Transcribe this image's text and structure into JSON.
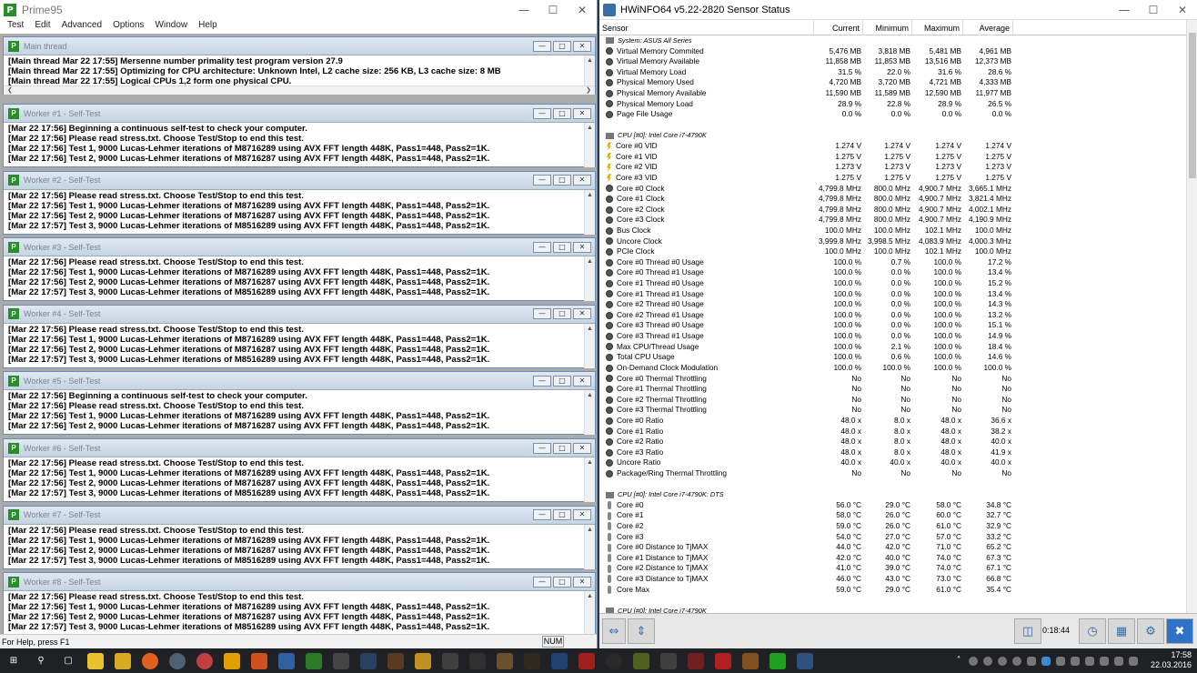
{
  "prime": {
    "title": "Prime95",
    "menus": [
      "Test",
      "Edit",
      "Advanced",
      "Options",
      "Window",
      "Help"
    ],
    "main_title": "Main thread",
    "main_lines": [
      "[Main thread Mar 22 17:55] Mersenne number primality test program version 27.9",
      "[Main thread Mar 22 17:55] Optimizing for CPU architecture: Unknown Intel, L2 cache size: 256 KB, L3 cache size: 8 MB",
      "[Main thread Mar 22 17:55] Logical CPUs 1,2 form one physical CPU."
    ],
    "workers": [
      {
        "title": "Worker #1 - Self-Test",
        "lines": [
          "[Mar 22 17:56] Beginning a continuous self-test to check your computer.",
          "[Mar 22 17:56] Please read stress.txt.  Choose Test/Stop to end this test.",
          "[Mar 22 17:56] Test 1, 9000 Lucas-Lehmer iterations of M8716289 using AVX FFT length 448K, Pass1=448, Pass2=1K.",
          "[Mar 22 17:56] Test 2, 9000 Lucas-Lehmer iterations of M8716287 using AVX FFT length 448K, Pass1=448, Pass2=1K."
        ]
      },
      {
        "title": "Worker #2 - Self-Test",
        "lines": [
          "[Mar 22 17:56] Please read stress.txt.  Choose Test/Stop to end this test.",
          "[Mar 22 17:56] Test 1, 9000 Lucas-Lehmer iterations of M8716289 using AVX FFT length 448K, Pass1=448, Pass2=1K.",
          "[Mar 22 17:56] Test 2, 9000 Lucas-Lehmer iterations of M8716287 using AVX FFT length 448K, Pass1=448, Pass2=1K.",
          "[Mar 22 17:57] Test 3, 9000 Lucas-Lehmer iterations of M8516289 using AVX FFT length 448K, Pass1=448, Pass2=1K."
        ]
      },
      {
        "title": "Worker #3 - Self-Test",
        "lines": [
          "[Mar 22 17:56] Please read stress.txt.  Choose Test/Stop to end this test.",
          "[Mar 22 17:56] Test 1, 9000 Lucas-Lehmer iterations of M8716289 using AVX FFT length 448K, Pass1=448, Pass2=1K.",
          "[Mar 22 17:56] Test 2, 9000 Lucas-Lehmer iterations of M8716287 using AVX FFT length 448K, Pass1=448, Pass2=1K.",
          "[Mar 22 17:57] Test 3, 9000 Lucas-Lehmer iterations of M8516289 using AVX FFT length 448K, Pass1=448, Pass2=1K."
        ]
      },
      {
        "title": "Worker #4 - Self-Test",
        "lines": [
          "[Mar 22 17:56] Please read stress.txt.  Choose Test/Stop to end this test.",
          "[Mar 22 17:56] Test 1, 9000 Lucas-Lehmer iterations of M8716289 using AVX FFT length 448K, Pass1=448, Pass2=1K.",
          "[Mar 22 17:56] Test 2, 9000 Lucas-Lehmer iterations of M8716287 using AVX FFT length 448K, Pass1=448, Pass2=1K.",
          "[Mar 22 17:57] Test 3, 9000 Lucas-Lehmer iterations of M8516289 using AVX FFT length 448K, Pass1=448, Pass2=1K."
        ]
      },
      {
        "title": "Worker #5 - Self-Test",
        "lines": [
          "[Mar 22 17:56] Beginning a continuous self-test to check your computer.",
          "[Mar 22 17:56] Please read stress.txt.  Choose Test/Stop to end this test.",
          "[Mar 22 17:56] Test 1, 9000 Lucas-Lehmer iterations of M8716289 using AVX FFT length 448K, Pass1=448, Pass2=1K.",
          "[Mar 22 17:56] Test 2, 9000 Lucas-Lehmer iterations of M8716287 using AVX FFT length 448K, Pass1=448, Pass2=1K."
        ]
      },
      {
        "title": "Worker #6 - Self-Test",
        "lines": [
          "[Mar 22 17:56] Please read stress.txt.  Choose Test/Stop to end this test.",
          "[Mar 22 17:56] Test 1, 9000 Lucas-Lehmer iterations of M8716289 using AVX FFT length 448K, Pass1=448, Pass2=1K.",
          "[Mar 22 17:56] Test 2, 9000 Lucas-Lehmer iterations of M8716287 using AVX FFT length 448K, Pass1=448, Pass2=1K.",
          "[Mar 22 17:57] Test 3, 9000 Lucas-Lehmer iterations of M8516289 using AVX FFT length 448K, Pass1=448, Pass2=1K."
        ]
      },
      {
        "title": "Worker #7 - Self-Test",
        "lines": [
          "[Mar 22 17:56] Please read stress.txt.  Choose Test/Stop to end this test.",
          "[Mar 22 17:56] Test 1, 9000 Lucas-Lehmer iterations of M8716289 using AVX FFT length 448K, Pass1=448, Pass2=1K.",
          "[Mar 22 17:56] Test 2, 9000 Lucas-Lehmer iterations of M8716287 using AVX FFT length 448K, Pass1=448, Pass2=1K.",
          "[Mar 22 17:57] Test 3, 9000 Lucas-Lehmer iterations of M8516289 using AVX FFT length 448K, Pass1=448, Pass2=1K."
        ]
      },
      {
        "title": "Worker #8 - Self-Test",
        "lines": [
          "[Mar 22 17:56] Please read stress.txt.  Choose Test/Stop to end this test.",
          "[Mar 22 17:56] Test 1, 9000 Lucas-Lehmer iterations of M8716289 using AVX FFT length 448K, Pass1=448, Pass2=1K.",
          "[Mar 22 17:56] Test 2, 9000 Lucas-Lehmer iterations of M8716287 using AVX FFT length 448K, Pass1=448, Pass2=1K.",
          "[Mar 22 17:57] Test 3, 9000 Lucas-Lehmer iterations of M8516289 using AVX FFT length 448K, Pass1=448, Pass2=1K."
        ]
      }
    ],
    "status_text": "For Help, press F1",
    "status_num": "NUM"
  },
  "hwinfo": {
    "title": "HWiNFO64 v5.22-2820 Sensor Status",
    "columns": {
      "sensor": "Sensor",
      "current": "Current",
      "minimum": "Minimum",
      "maximum": "Maximum",
      "average": "Average"
    },
    "rows": [
      {
        "kind": "group",
        "name": "System: ASUS All Series"
      },
      {
        "kind": "dot",
        "name": "Virtual Memory Commited",
        "cur": "5,476 MB",
        "min": "3,818 MB",
        "max": "5,481 MB",
        "avg": "4,961 MB"
      },
      {
        "kind": "dot",
        "name": "Virtual Memory Available",
        "cur": "11,858 MB",
        "min": "11,853 MB",
        "max": "13,516 MB",
        "avg": "12,373 MB"
      },
      {
        "kind": "dot",
        "name": "Virtual Memory Load",
        "cur": "31.5 %",
        "min": "22.0 %",
        "max": "31.6 %",
        "avg": "28.6 %"
      },
      {
        "kind": "dot",
        "name": "Physical Memory Used",
        "cur": "4,720 MB",
        "min": "3,720 MB",
        "max": "4,721 MB",
        "avg": "4,333 MB"
      },
      {
        "kind": "dot",
        "name": "Physical Memory Available",
        "cur": "11,590 MB",
        "min": "11,589 MB",
        "max": "12,590 MB",
        "avg": "11,977 MB"
      },
      {
        "kind": "dot",
        "name": "Physical Memory Load",
        "cur": "28.9 %",
        "min": "22.8 %",
        "max": "28.9 %",
        "avg": "26.5 %"
      },
      {
        "kind": "dot",
        "name": "Page File Usage",
        "cur": "0.0 %",
        "min": "0.0 %",
        "max": "0.0 %",
        "avg": "0.0 %"
      },
      {
        "kind": "blank"
      },
      {
        "kind": "group",
        "name": "CPU [#0]: Intel Core i7-4790K"
      },
      {
        "kind": "volt",
        "name": "Core #0 VID",
        "cur": "1.274 V",
        "min": "1.274 V",
        "max": "1.274 V",
        "avg": "1.274 V"
      },
      {
        "kind": "volt",
        "name": "Core #1 VID",
        "cur": "1.275 V",
        "min": "1.275 V",
        "max": "1.275 V",
        "avg": "1.275 V"
      },
      {
        "kind": "volt",
        "name": "Core #2 VID",
        "cur": "1.273 V",
        "min": "1.273 V",
        "max": "1.273 V",
        "avg": "1.273 V"
      },
      {
        "kind": "volt",
        "name": "Core #3 VID",
        "cur": "1.275 V",
        "min": "1.275 V",
        "max": "1.275 V",
        "avg": "1.275 V"
      },
      {
        "kind": "dot",
        "name": "Core #0 Clock",
        "cur": "4,799.8 MHz",
        "min": "800.0 MHz",
        "max": "4,900.7 MHz",
        "avg": "3,665.1 MHz"
      },
      {
        "kind": "dot",
        "name": "Core #1 Clock",
        "cur": "4,799.8 MHz",
        "min": "800.0 MHz",
        "max": "4,900.7 MHz",
        "avg": "3,821.4 MHz"
      },
      {
        "kind": "dot",
        "name": "Core #2 Clock",
        "cur": "4,799.8 MHz",
        "min": "800.0 MHz",
        "max": "4,900.7 MHz",
        "avg": "4,002.1 MHz"
      },
      {
        "kind": "dot",
        "name": "Core #3 Clock",
        "cur": "4,799.8 MHz",
        "min": "800.0 MHz",
        "max": "4,900.7 MHz",
        "avg": "4,190.9 MHz"
      },
      {
        "kind": "dot",
        "name": "Bus Clock",
        "cur": "100.0 MHz",
        "min": "100.0 MHz",
        "max": "102.1 MHz",
        "avg": "100.0 MHz"
      },
      {
        "kind": "dot",
        "name": "Uncore Clock",
        "cur": "3,999.8 MHz",
        "min": "3,998.5 MHz",
        "max": "4,083.9 MHz",
        "avg": "4,000.3 MHz"
      },
      {
        "kind": "dot",
        "name": "PCIe Clock",
        "cur": "100.0 MHz",
        "min": "100.0 MHz",
        "max": "102.1 MHz",
        "avg": "100.0 MHz"
      },
      {
        "kind": "dot",
        "name": "Core #0 Thread #0 Usage",
        "cur": "100.0 %",
        "min": "0.7 %",
        "max": "100.0 %",
        "avg": "17.2 %"
      },
      {
        "kind": "dot",
        "name": "Core #0 Thread #1 Usage",
        "cur": "100.0 %",
        "min": "0.0 %",
        "max": "100.0 %",
        "avg": "13.4 %"
      },
      {
        "kind": "dot",
        "name": "Core #1 Thread #0 Usage",
        "cur": "100.0 %",
        "min": "0.0 %",
        "max": "100.0 %",
        "avg": "15.2 %"
      },
      {
        "kind": "dot",
        "name": "Core #1 Thread #1 Usage",
        "cur": "100.0 %",
        "min": "0.0 %",
        "max": "100.0 %",
        "avg": "13.4 %"
      },
      {
        "kind": "dot",
        "name": "Core #2 Thread #0 Usage",
        "cur": "100.0 %",
        "min": "0.0 %",
        "max": "100.0 %",
        "avg": "14.3 %"
      },
      {
        "kind": "dot",
        "name": "Core #2 Thread #1 Usage",
        "cur": "100.0 %",
        "min": "0.0 %",
        "max": "100.0 %",
        "avg": "13.2 %"
      },
      {
        "kind": "dot",
        "name": "Core #3 Thread #0 Usage",
        "cur": "100.0 %",
        "min": "0.0 %",
        "max": "100.0 %",
        "avg": "15.1 %"
      },
      {
        "kind": "dot",
        "name": "Core #3 Thread #1 Usage",
        "cur": "100.0 %",
        "min": "0.0 %",
        "max": "100.0 %",
        "avg": "14.9 %"
      },
      {
        "kind": "dot",
        "name": "Max CPU/Thread Usage",
        "cur": "100.0 %",
        "min": "2.1 %",
        "max": "100.0 %",
        "avg": "18.4 %"
      },
      {
        "kind": "dot",
        "name": "Total CPU Usage",
        "cur": "100.0 %",
        "min": "0.6 %",
        "max": "100.0 %",
        "avg": "14.6 %"
      },
      {
        "kind": "dot",
        "name": "On-Demand Clock Modulation",
        "cur": "100.0 %",
        "min": "100.0 %",
        "max": "100.0 %",
        "avg": "100.0 %"
      },
      {
        "kind": "dot",
        "name": "Core #0 Thermal Throttling",
        "cur": "No",
        "min": "No",
        "max": "No",
        "avg": "No"
      },
      {
        "kind": "dot",
        "name": "Core #1 Thermal Throttling",
        "cur": "No",
        "min": "No",
        "max": "No",
        "avg": "No"
      },
      {
        "kind": "dot",
        "name": "Core #2 Thermal Throttling",
        "cur": "No",
        "min": "No",
        "max": "No",
        "avg": "No"
      },
      {
        "kind": "dot",
        "name": "Core #3 Thermal Throttling",
        "cur": "No",
        "min": "No",
        "max": "No",
        "avg": "No"
      },
      {
        "kind": "dot",
        "name": "Core #0 Ratio",
        "cur": "48.0 x",
        "min": "8.0 x",
        "max": "48.0 x",
        "avg": "36.6 x"
      },
      {
        "kind": "dot",
        "name": "Core #1 Ratio",
        "cur": "48.0 x",
        "min": "8.0 x",
        "max": "48.0 x",
        "avg": "38.2 x"
      },
      {
        "kind": "dot",
        "name": "Core #2 Ratio",
        "cur": "48.0 x",
        "min": "8.0 x",
        "max": "48.0 x",
        "avg": "40.0 x"
      },
      {
        "kind": "dot",
        "name": "Core #3 Ratio",
        "cur": "48.0 x",
        "min": "8.0 x",
        "max": "48.0 x",
        "avg": "41.9 x"
      },
      {
        "kind": "dot",
        "name": "Uncore Ratio",
        "cur": "40.0 x",
        "min": "40.0 x",
        "max": "40.0 x",
        "avg": "40.0 x"
      },
      {
        "kind": "dot",
        "name": "Package/Ring Thermal Throttling",
        "cur": "No",
        "min": "No",
        "max": "No",
        "avg": "No"
      },
      {
        "kind": "blank"
      },
      {
        "kind": "group",
        "name": "CPU [#0]: Intel Core i7-4790K: DTS"
      },
      {
        "kind": "therm",
        "name": "Core #0",
        "cur": "56.0 °C",
        "min": "29.0 °C",
        "max": "58.0 °C",
        "avg": "34.8 °C"
      },
      {
        "kind": "therm",
        "name": "Core #1",
        "cur": "58.0 °C",
        "min": "26.0 °C",
        "max": "60.0 °C",
        "avg": "32.7 °C"
      },
      {
        "kind": "therm",
        "name": "Core #2",
        "cur": "59.0 °C",
        "min": "26.0 °C",
        "max": "61.0 °C",
        "avg": "32.9 °C"
      },
      {
        "kind": "therm",
        "name": "Core #3",
        "cur": "54.0 °C",
        "min": "27.0 °C",
        "max": "57.0 °C",
        "avg": "33.2 °C"
      },
      {
        "kind": "therm",
        "name": "Core #0 Distance to TjMAX",
        "cur": "44.0 °C",
        "min": "42.0 °C",
        "max": "71.0 °C",
        "avg": "65.2 °C"
      },
      {
        "kind": "therm",
        "name": "Core #1 Distance to TjMAX",
        "cur": "42.0 °C",
        "min": "40.0 °C",
        "max": "74.0 °C",
        "avg": "67.3 °C"
      },
      {
        "kind": "therm",
        "name": "Core #2 Distance to TjMAX",
        "cur": "41.0 °C",
        "min": "39.0 °C",
        "max": "74.0 °C",
        "avg": "67.1 °C"
      },
      {
        "kind": "therm",
        "name": "Core #3 Distance to TjMAX",
        "cur": "46.0 °C",
        "min": "43.0 °C",
        "max": "73.0 °C",
        "avg": "66.8 °C"
      },
      {
        "kind": "therm",
        "name": "Core Max",
        "cur": "59.0 °C",
        "min": "29.0 °C",
        "max": "61.0 °C",
        "avg": "35.4 °C"
      },
      {
        "kind": "blank"
      },
      {
        "kind": "group",
        "name": "CPU [#0]: Intel Core i7-4790K"
      }
    ],
    "timer": "0:18:44"
  },
  "taskbar": {
    "time": "17:58",
    "date": "22.03.2016"
  }
}
